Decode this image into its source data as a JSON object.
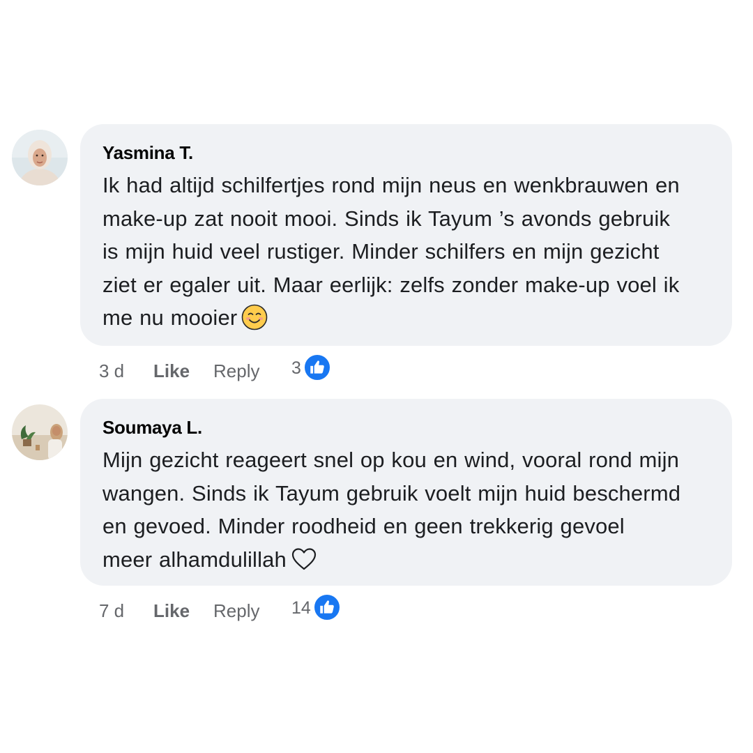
{
  "comments": [
    {
      "author": "Yasmina T.",
      "avatar_icon": "avatar-woman-hijab-icon",
      "text_lines": [
        "Ik had altijd schilfertjes rond mijn neus en wenkbrauwen en",
        "make-up zat nooit mooi. Sinds ik Tayum ’s avonds gebruik",
        "is mijn huid veel rustiger. Minder schilfers en mijn gezicht",
        "ziet er egaler uit. Maar eerlijk: zelfs zonder make-up voel ik",
        "me nu mooier"
      ],
      "end_icon": "smiling-face-emoji-icon",
      "time": "3 d",
      "like_label": "Like",
      "reply_label": "Reply",
      "reaction_count": "3",
      "reaction_icon": "thumbs-up-icon"
    },
    {
      "author": "Soumaya L.",
      "avatar_icon": "avatar-woman-plants-icon",
      "text_lines": [
        "Mijn gezicht reageert snel op kou en wind, vooral rond mijn",
        "wangen. Sinds ik Tayum gebruik voelt mijn huid beschermd",
        "en gevoed. Minder roodheid en geen trekkerig gevoel",
        "meer alhamdulillah"
      ],
      "end_icon": "heart-outline-icon",
      "time": "7 d",
      "like_label": "Like",
      "reply_label": "Reply",
      "reaction_count": "14",
      "reaction_icon": "thumbs-up-icon"
    }
  ],
  "colors": {
    "bubble_bg": "#f0f2f5",
    "meta_text": "#65676b",
    "like_blue": "#1877f2"
  }
}
